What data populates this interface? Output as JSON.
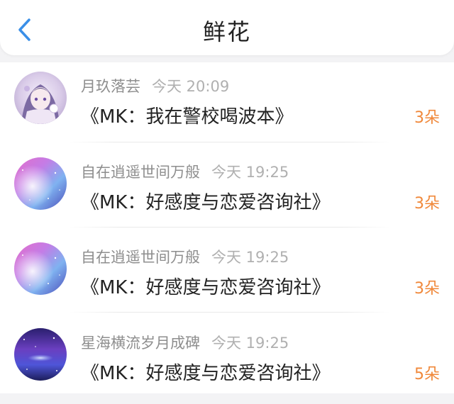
{
  "header": {
    "title": "鲜花",
    "back_icon": "chevron-left-icon",
    "accent": "#3a8fe8"
  },
  "items": [
    {
      "name": "月玖落芸",
      "time": "今天 20:09",
      "book": "《MK：我在警校喝波本》",
      "count": "3朵",
      "avatar": "anime-girl-avatar"
    },
    {
      "name": "自在逍遥世间万般",
      "time": "今天 19:25",
      "book": "《MK：好感度与恋爱咨询社》",
      "count": "3朵",
      "avatar": "galaxy-avatar"
    },
    {
      "name": "自在逍遥世间万般",
      "time": "今天 19:25",
      "book": "《MK：好感度与恋爱咨询社》",
      "count": "3朵",
      "avatar": "galaxy-avatar"
    },
    {
      "name": "星海横流岁月成碑",
      "time": "今天 19:25",
      "book": "《MK：好感度与恋爱咨询社》",
      "count": "5朵",
      "avatar": "nebula-avatar"
    }
  ]
}
